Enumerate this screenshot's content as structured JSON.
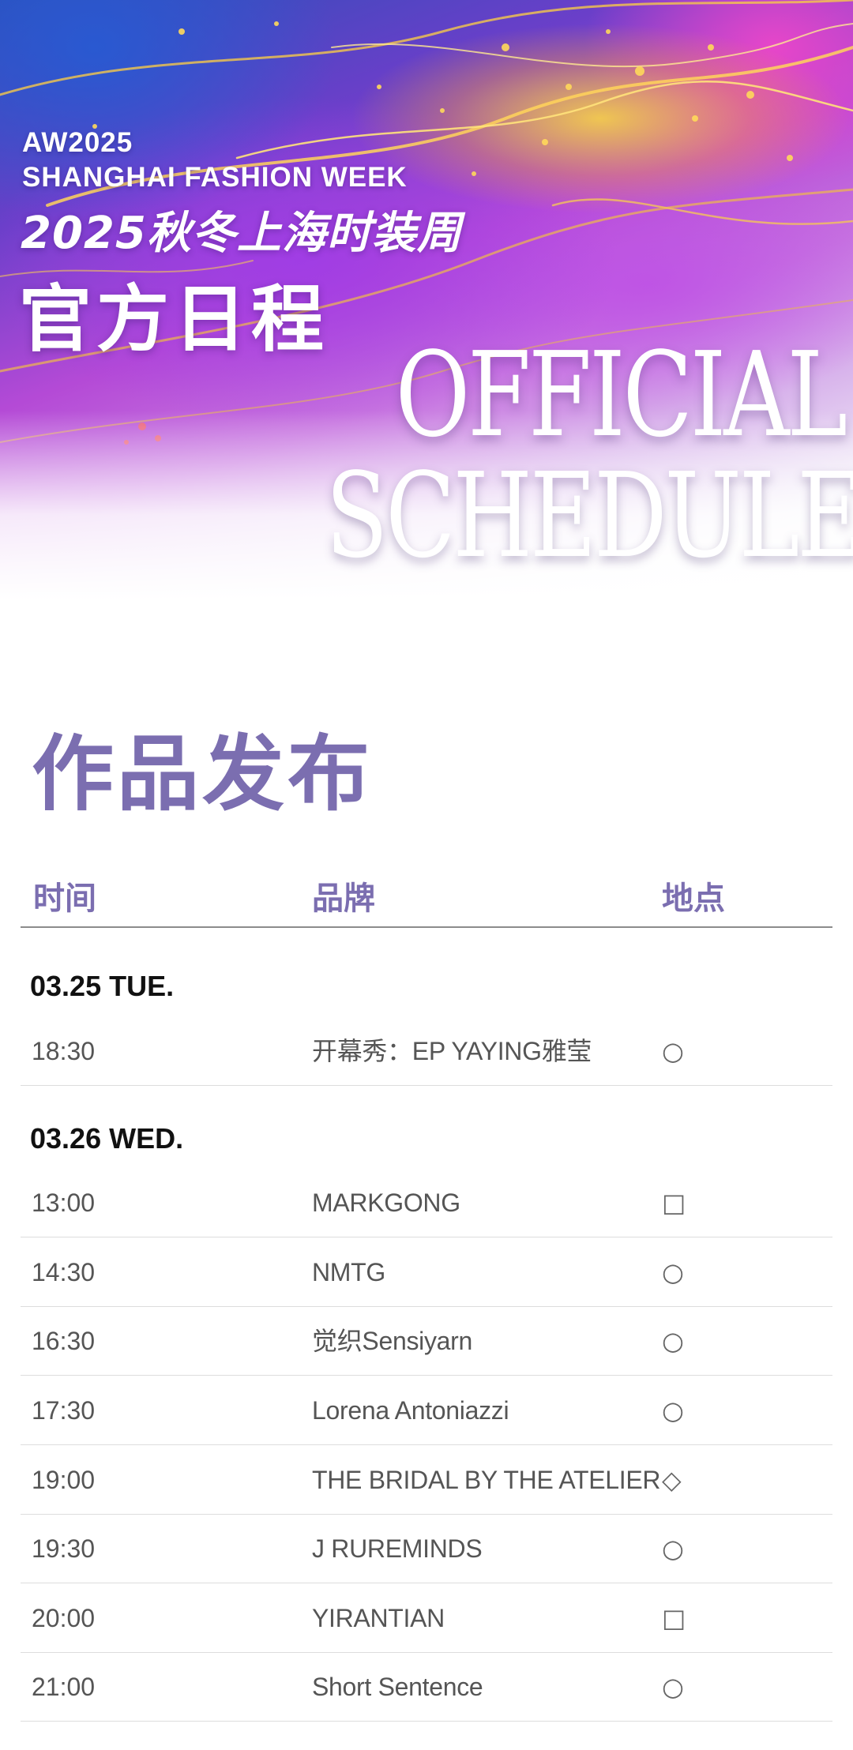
{
  "hero": {
    "line1": "AW2025",
    "line2": "SHANGHAI FASHION WEEK",
    "cn_subtitle": "2025秋冬上海时装周",
    "cn_title": "官方日程",
    "big_word_1": "OFFICIAL",
    "big_word_2": "SCHEDULE"
  },
  "section": {
    "title": "作品发布",
    "columns": [
      "时间",
      "品牌",
      "地点"
    ]
  },
  "days": [
    {
      "date": "03.25 TUE.",
      "rows": [
        {
          "time": "18:30",
          "brand": "开幕秀：EP YAYING雅莹",
          "venue": "○"
        }
      ]
    },
    {
      "date": "03.26 WED.",
      "rows": [
        {
          "time": "13:00",
          "brand": "MARKGONG",
          "venue": "□"
        },
        {
          "time": "14:30",
          "brand": "NMTG",
          "venue": "○"
        },
        {
          "time": "16:30",
          "brand": "觉织Sensiyarn",
          "venue": "○"
        },
        {
          "time": "17:30",
          "brand": "Lorena Antoniazzi",
          "venue": "○"
        },
        {
          "time": "19:00",
          "brand": "THE BRIDAL BY THE ATELIER",
          "venue": "◇"
        },
        {
          "time": "19:30",
          "brand": "J RUREMINDS",
          "venue": "○"
        },
        {
          "time": "20:00",
          "brand": "YIRANTIAN",
          "venue": "□"
        },
        {
          "time": "21:00",
          "brand": "Short Sentence",
          "venue": "○"
        }
      ]
    }
  ]
}
